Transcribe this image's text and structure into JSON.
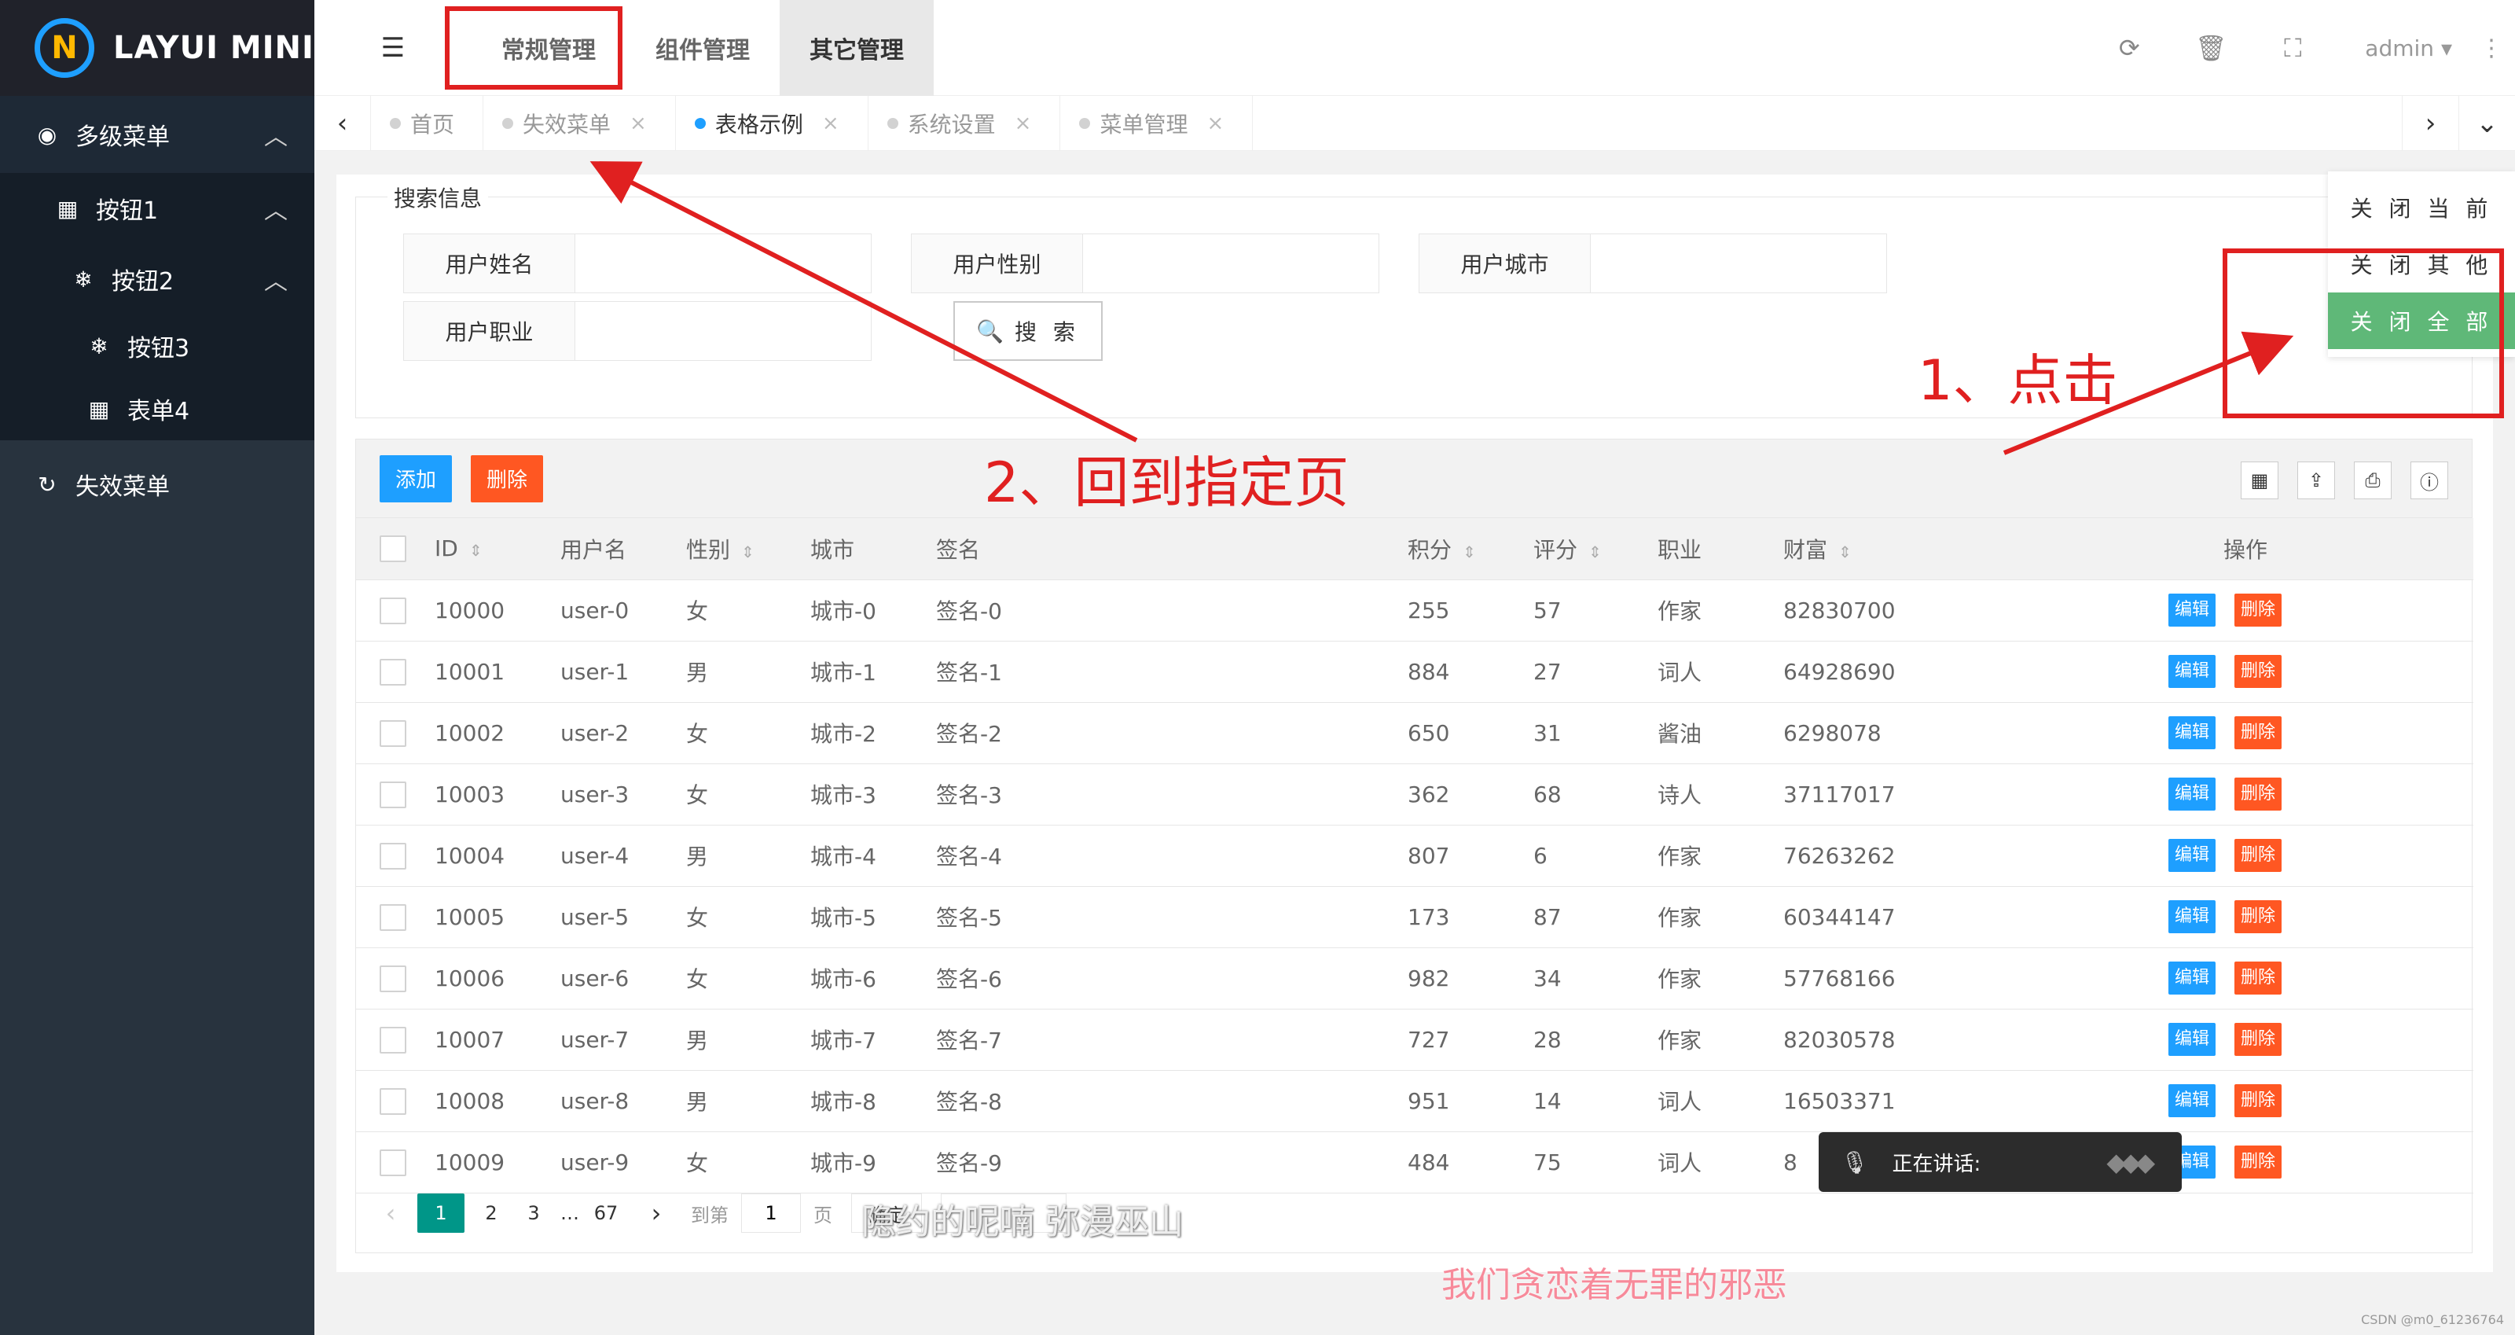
{
  "app": {
    "logo_mark": "N",
    "title": "LAYUI MINI"
  },
  "sidebar": {
    "top": {
      "icon": "◉",
      "label": "多级菜单"
    },
    "items": [
      {
        "icon": "▦",
        "label": "按钮1"
      },
      {
        "icon": "❄",
        "label": "按钮2"
      },
      {
        "icon": "❄",
        "label": "按钮3"
      },
      {
        "icon": "▦",
        "label": "表单4"
      }
    ],
    "bottom": {
      "icon": "↻",
      "label": "失效菜单"
    }
  },
  "header": {
    "menu_icon": "☰",
    "nav": [
      "常规管理",
      "组件管理",
      "其它管理"
    ],
    "user": "admin",
    "caret": "▾",
    "more": "⋮"
  },
  "tabs": {
    "prev": "‹",
    "next": "›",
    "expand": "⌄",
    "items": [
      {
        "label": "首页",
        "close": ""
      },
      {
        "label": "失效菜单",
        "close": "×"
      },
      {
        "label": "表格示例",
        "close": "×"
      },
      {
        "label": "系统设置",
        "close": "×"
      },
      {
        "label": "菜单管理",
        "close": "×"
      }
    ]
  },
  "tab_menu": [
    "关 闭 当 前",
    "关 闭 其 他",
    "关 闭 全 部"
  ],
  "search": {
    "legend": "搜索信息",
    "fields": [
      "用户姓名",
      "用户性别",
      "用户城市",
      "用户职业"
    ],
    "button": "搜 索"
  },
  "toolbar": {
    "add": "添加",
    "delete": "删除"
  },
  "table": {
    "columns": [
      "ID",
      "用户名",
      "性别",
      "城市",
      "签名",
      "积分",
      "评分",
      "职业",
      "财富",
      "操作"
    ],
    "sort_icon": "⇕",
    "edit": "编辑",
    "remove": "删除",
    "rows": [
      [
        "10000",
        "user-0",
        "女",
        "城市-0",
        "签名-0",
        "255",
        "57",
        "作家",
        "82830700"
      ],
      [
        "10001",
        "user-1",
        "男",
        "城市-1",
        "签名-1",
        "884",
        "27",
        "词人",
        "64928690"
      ],
      [
        "10002",
        "user-2",
        "女",
        "城市-2",
        "签名-2",
        "650",
        "31",
        "酱油",
        "6298078"
      ],
      [
        "10003",
        "user-3",
        "女",
        "城市-3",
        "签名-3",
        "362",
        "68",
        "诗人",
        "37117017"
      ],
      [
        "10004",
        "user-4",
        "男",
        "城市-4",
        "签名-4",
        "807",
        "6",
        "作家",
        "76263262"
      ],
      [
        "10005",
        "user-5",
        "女",
        "城市-5",
        "签名-5",
        "173",
        "87",
        "作家",
        "60344147"
      ],
      [
        "10006",
        "user-6",
        "女",
        "城市-6",
        "签名-6",
        "982",
        "34",
        "作家",
        "57768166"
      ],
      [
        "10007",
        "user-7",
        "男",
        "城市-7",
        "签名-7",
        "727",
        "28",
        "作家",
        "82030578"
      ],
      [
        "10008",
        "user-8",
        "男",
        "城市-8",
        "签名-8",
        "951",
        "14",
        "词人",
        "16503371"
      ],
      [
        "10009",
        "user-9",
        "女",
        "城市-9",
        "签名-9",
        "484",
        "75",
        "词人",
        "8"
      ]
    ]
  },
  "pager": {
    "prev": "‹",
    "pages": [
      "1",
      "2",
      "3",
      "…",
      "67"
    ],
    "next": "›",
    "goto": "到第",
    "goto_value": "1",
    "page_unit": "页",
    "confirm": "确定"
  },
  "voice": {
    "label": "正在讲话:"
  },
  "annotations": {
    "step1": "1、点击",
    "step2": "2、回到指定页"
  },
  "lyrics": [
    "隐约的呢喃 弥漫巫山",
    "我们贪恋着无罪的邪恶"
  ],
  "watermark": "CSDN @m0_61236764",
  "colors": {
    "primary": "#1e9fff",
    "danger": "#ff5722",
    "success": "#5fb878",
    "page_current": "#009688",
    "annotation": "#e02020"
  }
}
